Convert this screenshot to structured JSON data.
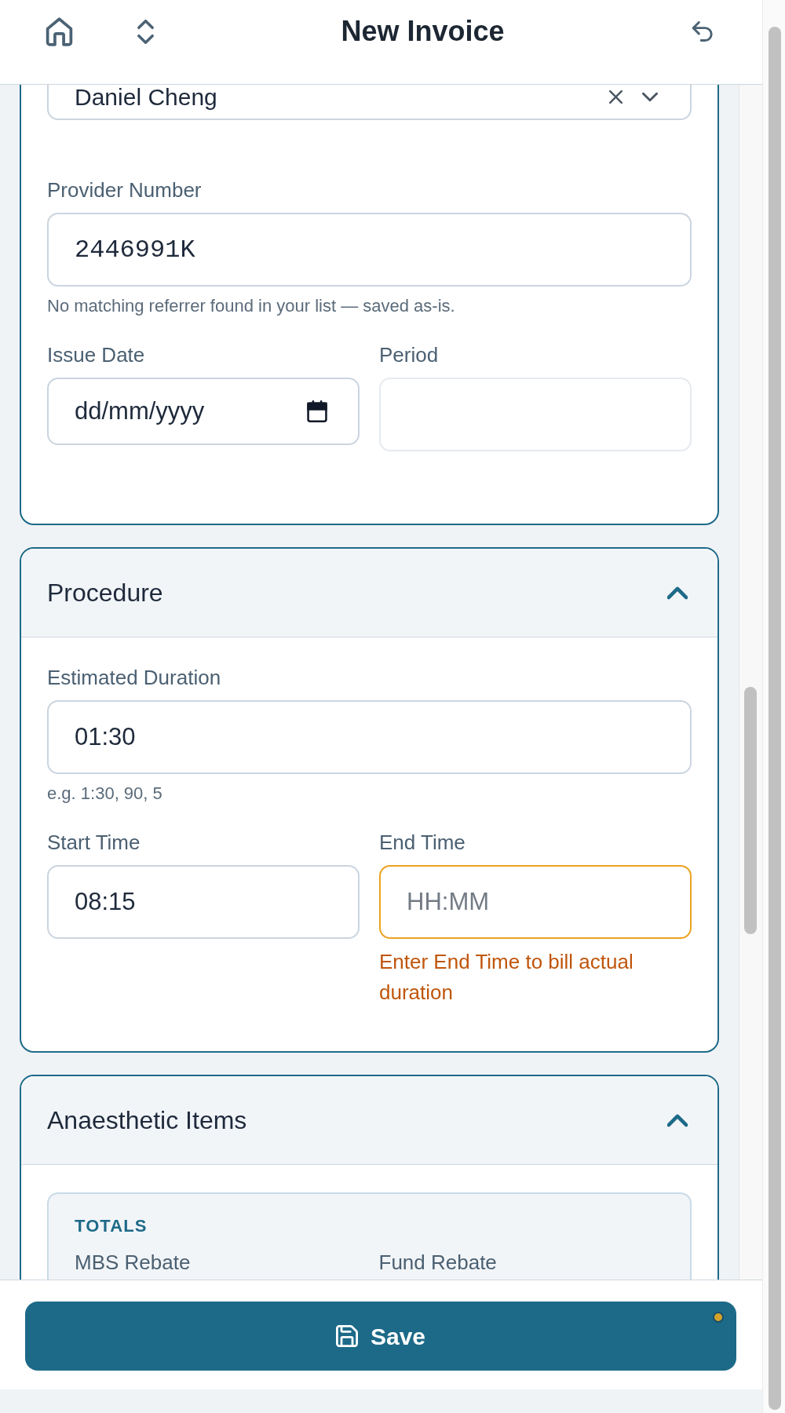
{
  "header": {
    "title": "New Invoice"
  },
  "sections": [
    {
      "kind": "details",
      "rows": [
        [
          {
            "kind": "select",
            "value": "Daniel Cheng",
            "disabled": false,
            "warning": false
          }
        ],
        [
          {
            "kind": "code",
            "label": "Provider Number",
            "value": "2446991K",
            "helper": "No matching referrer found in your list — saved as-is.",
            "disabled": false,
            "warning": false
          }
        ],
        [
          {
            "kind": "date",
            "label": "Issue Date",
            "placeholder": "dd/mm/yyyy",
            "disabled": false,
            "warning": false
          },
          {
            "kind": "text",
            "label": "Period",
            "disabled": true,
            "warning": false
          }
        ]
      ]
    },
    {
      "kind": "collapsible",
      "title": "Procedure",
      "expanded": true,
      "rows": [
        [
          {
            "kind": "text",
            "label": "Estimated Duration",
            "value": "01:30",
            "helper": "e.g. 1:30, 90, 5",
            "disabled": false,
            "warning": false
          }
        ],
        [
          {
            "kind": "text",
            "label": "Start Time",
            "value": "08:15",
            "disabled": false,
            "warning": false
          },
          {
            "kind": "text",
            "label": "End Time",
            "placeholder": "HH:MM",
            "message": "Enter End Time to bill actual duration",
            "disabled": false,
            "warning": true
          }
        ]
      ]
    },
    {
      "kind": "collapsible",
      "title": "Anaesthetic Items",
      "expanded": true,
      "totals": {
        "heading": "TOTALS",
        "labels": [
          "MBS Rebate",
          "Fund Rebate"
        ]
      }
    }
  ],
  "save_button": {
    "label": "Save",
    "unsaved_changes": true
  }
}
